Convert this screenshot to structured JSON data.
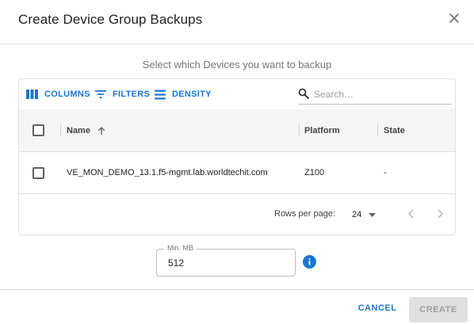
{
  "dialog": {
    "title": "Create Device Group Backups",
    "subtitle": "Select which Devices you want to backup"
  },
  "toolbar": {
    "columns_label": "COLUMNS",
    "filters_label": "FILTERS",
    "density_label": "DENSITY",
    "search_placeholder": "Search…",
    "search_value": ""
  },
  "table": {
    "columns": [
      "Name",
      "Platform",
      "State"
    ],
    "sort": {
      "column": "Name",
      "direction": "ascending"
    },
    "rows": [
      {
        "name": "VE_MON_DEMO_13.1.f5-mgmt.lab.worldtechit.com",
        "platform": "Z100",
        "state": "-",
        "selected": false
      }
    ]
  },
  "pagination": {
    "rows_per_page_label": "Rows per page:",
    "rows_per_page_value": "24"
  },
  "min_mb": {
    "label": "Min. MB",
    "value": "512"
  },
  "actions": {
    "cancel_label": "CANCEL",
    "create_label": "CREATE",
    "create_enabled": false
  },
  "colors": {
    "accent": "#1976d2",
    "header_bg": "#f5f5f5",
    "border": "#e0e0e0",
    "disabled_bg": "#e0e0e0",
    "disabled_text": "#9e9e9e"
  },
  "icons": [
    "close-icon",
    "columns-icon",
    "filter-icon",
    "density-icon",
    "search-icon",
    "sort-arrow-up-icon",
    "dropdown-arrow-icon",
    "chevron-left-icon",
    "chevron-right-icon",
    "info-icon"
  ]
}
